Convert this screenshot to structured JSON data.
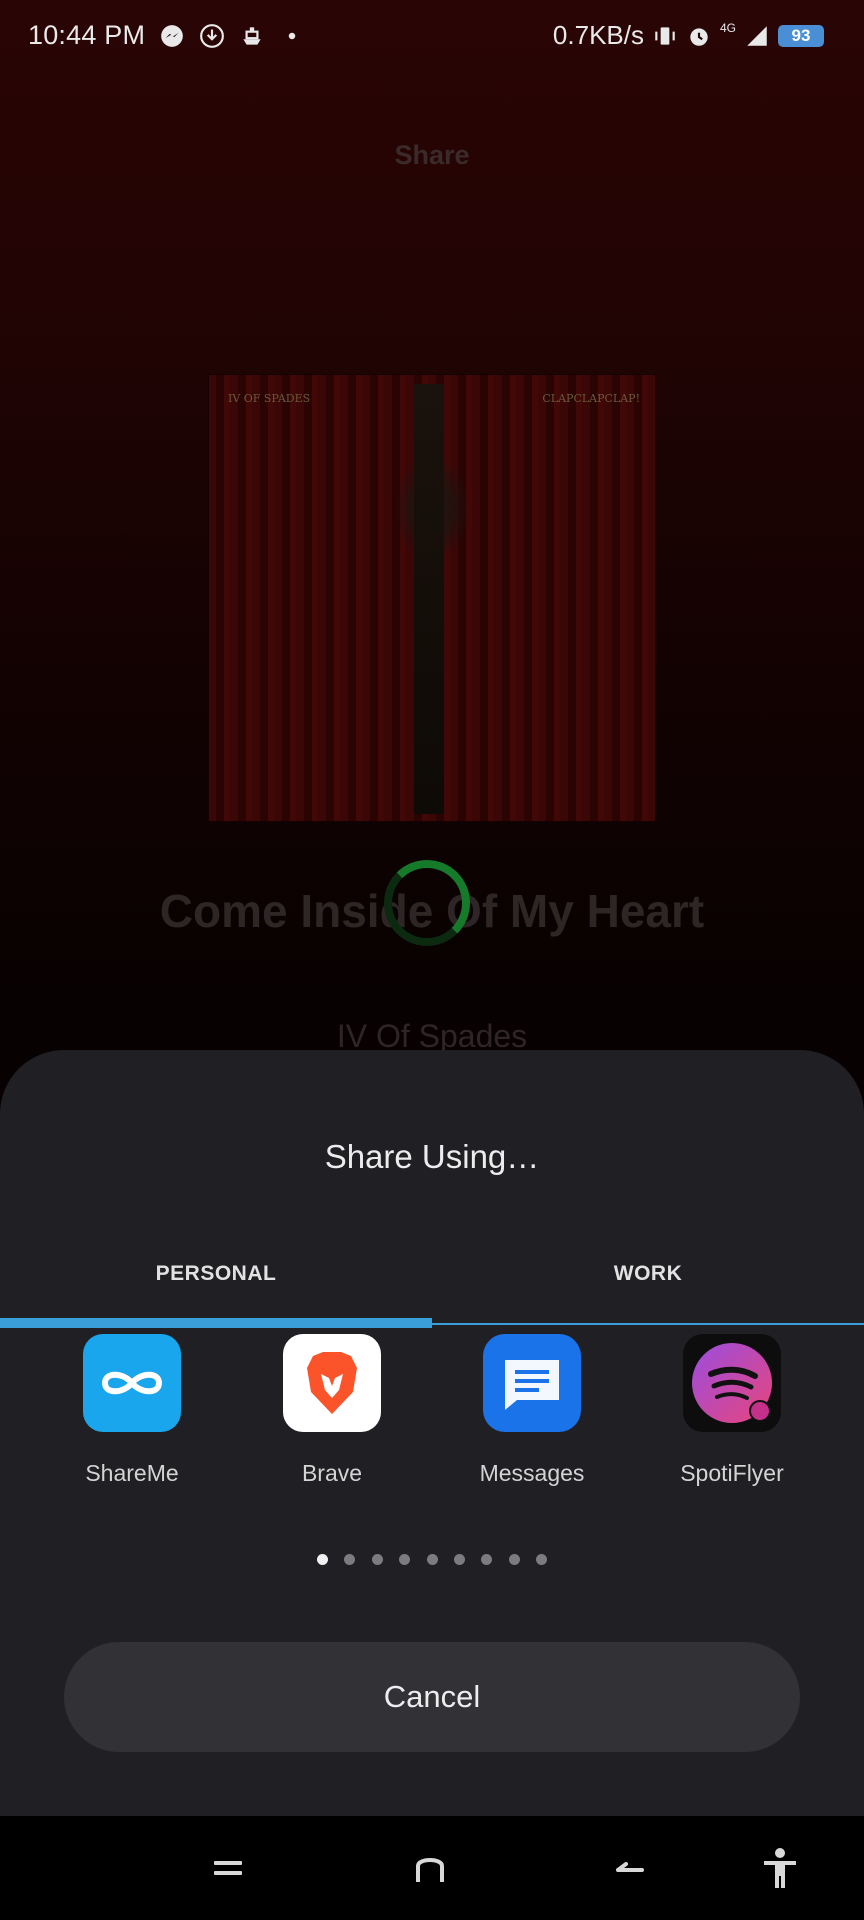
{
  "status_bar": {
    "time": "10:44 PM",
    "network_speed": "0.7KB/s",
    "network_type": "4G",
    "battery": "93",
    "icons": [
      "messenger-icon",
      "download-icon",
      "boat-icon",
      "dot-icon",
      "vibrate-icon",
      "alarm-icon",
      "signal-icon",
      "battery-icon"
    ]
  },
  "background": {
    "page_title": "Share",
    "song_title": "Come Inside Of My Heart",
    "artist": "IV Of Spades",
    "album_text_left": "IV OF SPADES",
    "album_text_right": "CLAPCLAPCLAP!",
    "spinner_color": "#157a2a"
  },
  "sheet": {
    "title": "Share Using…",
    "tabs": [
      {
        "label": "PERSONAL",
        "selected": true
      },
      {
        "label": "WORK",
        "selected": false
      }
    ],
    "accent_color": "#3a9fd8",
    "apps": [
      {
        "label": "ShareMe",
        "icon": "shareme-icon"
      },
      {
        "label": "Brave",
        "icon": "brave-icon"
      },
      {
        "label": "Messages",
        "icon": "messages-icon"
      },
      {
        "label": "SpotiFlyer",
        "icon": "spotiflyer-icon"
      }
    ],
    "page_count": 9,
    "current_page": 1,
    "cancel_label": "Cancel"
  },
  "nav_bar": {
    "buttons": [
      "menu-icon",
      "home-icon",
      "back-icon",
      "accessibility-icon"
    ]
  }
}
